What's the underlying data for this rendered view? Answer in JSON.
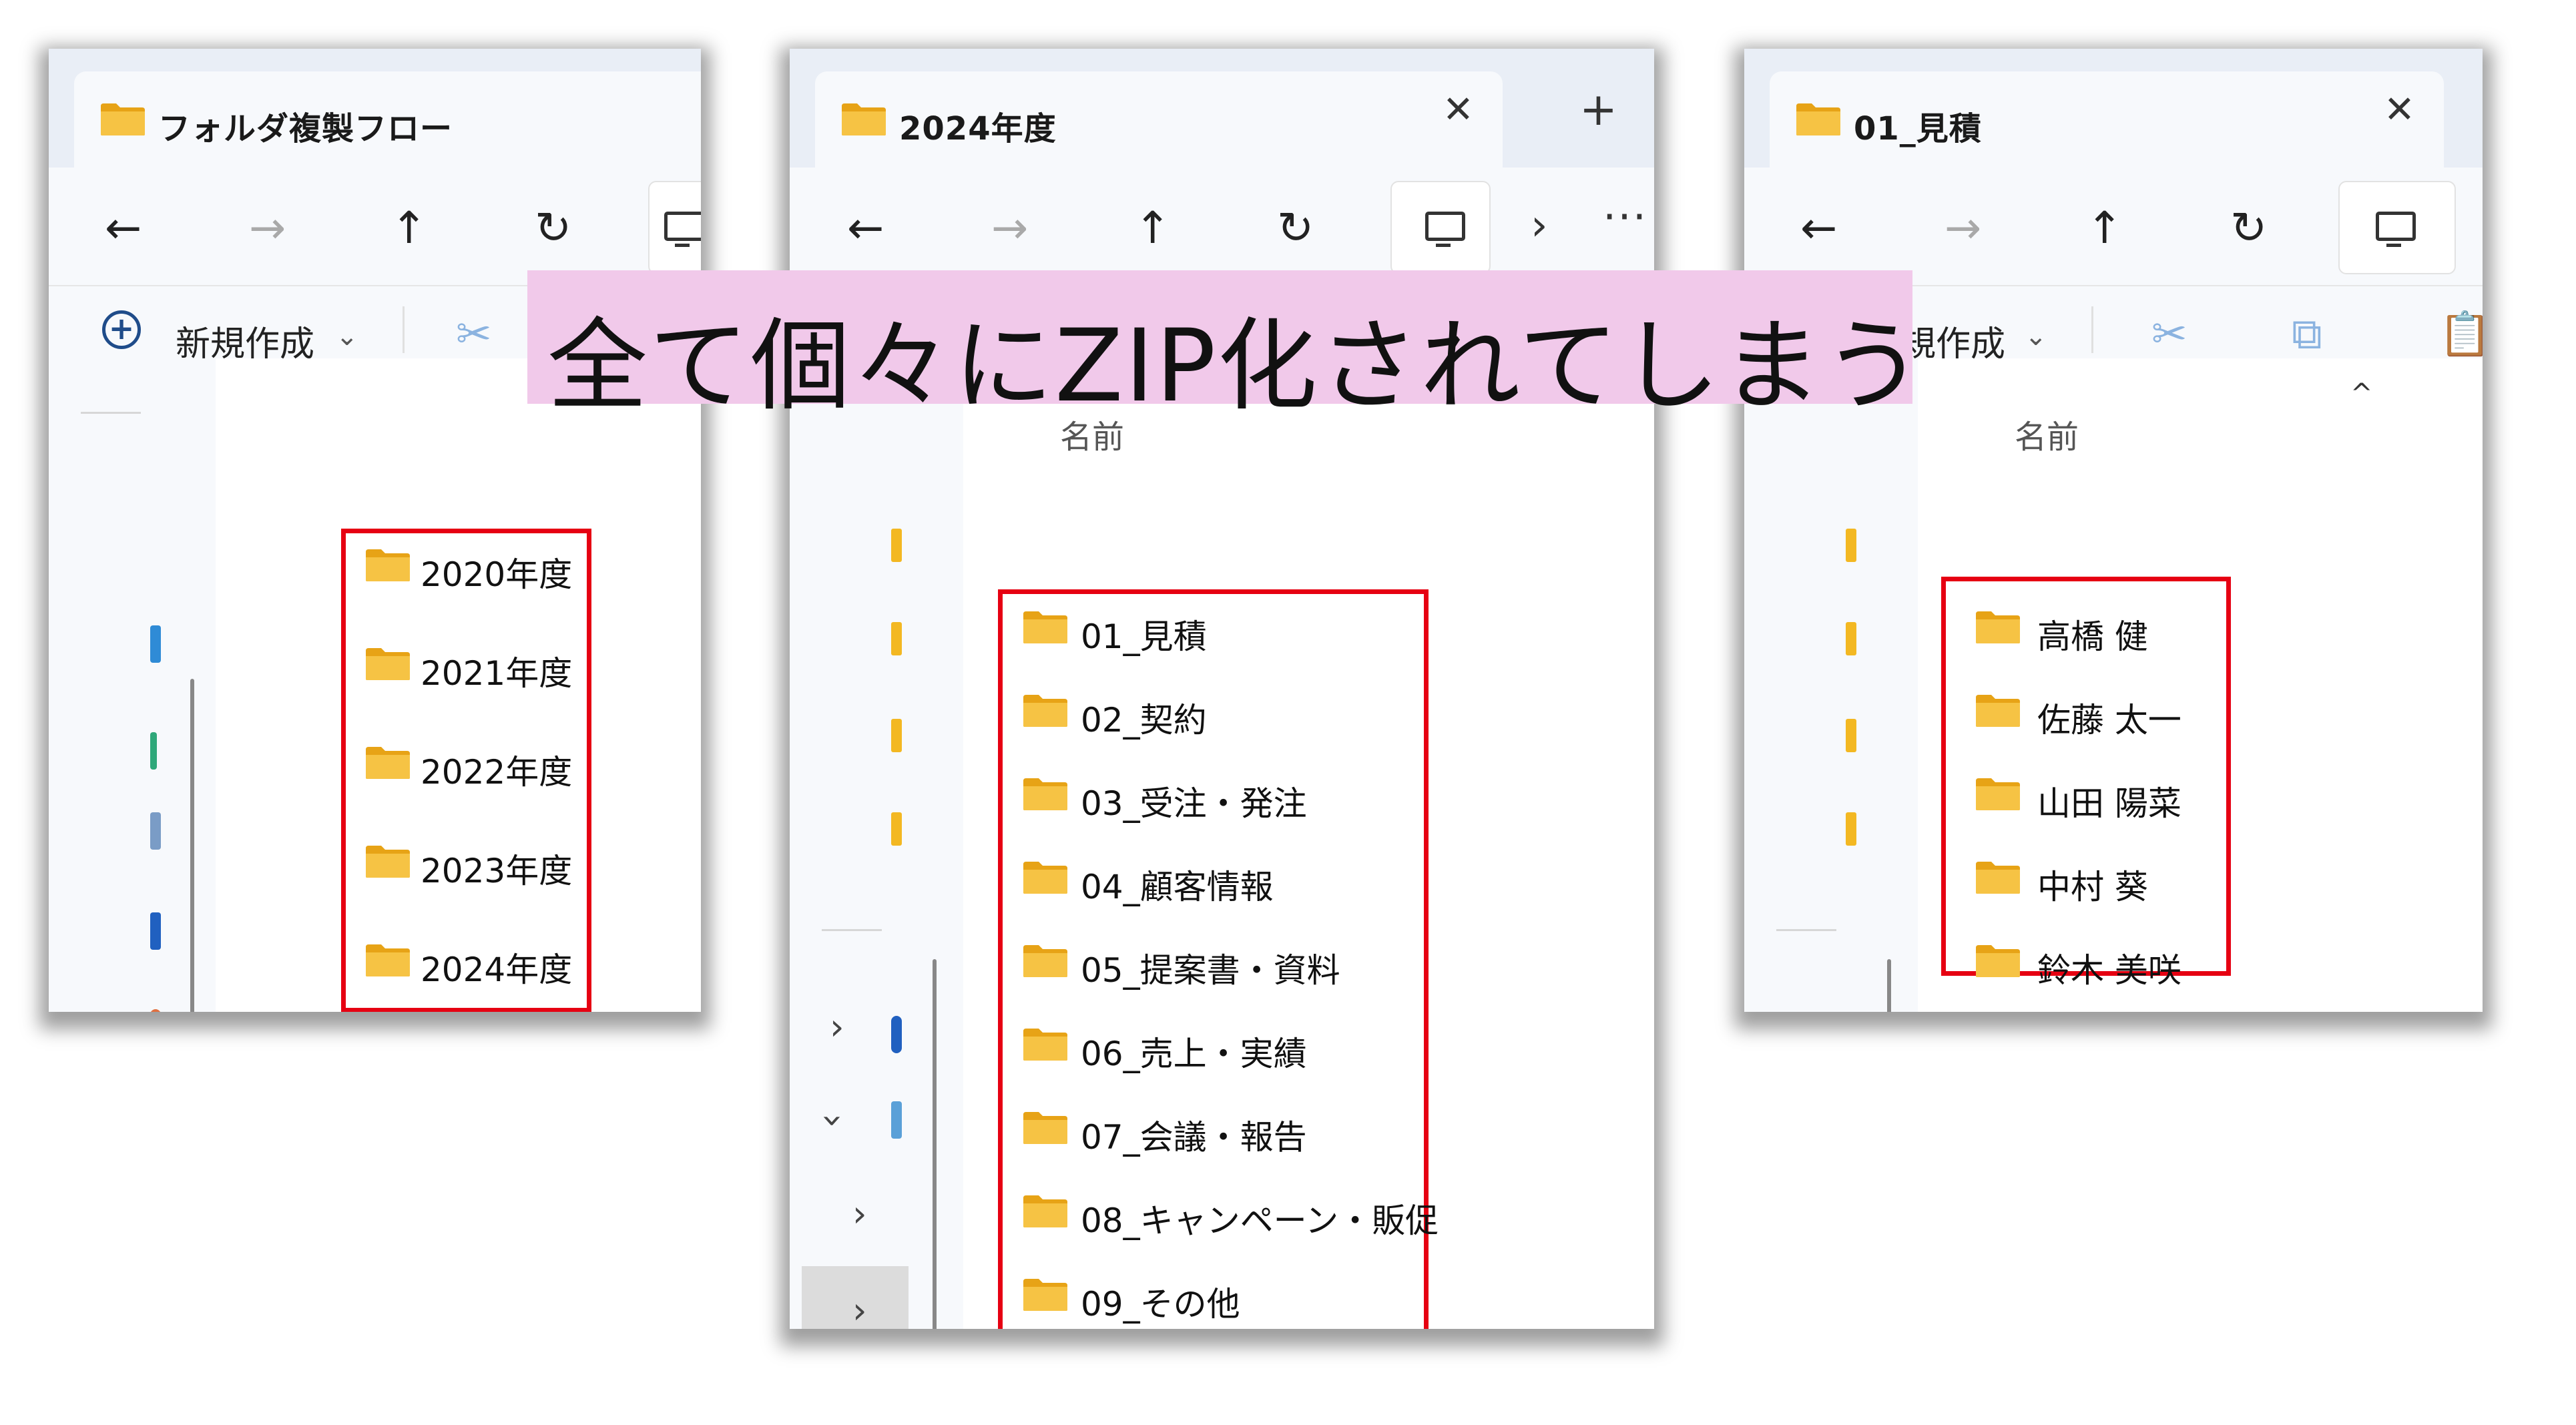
{
  "nav": {
    "back": "←",
    "forward": "→",
    "up": "↑",
    "refresh": "↻",
    "chevron": "›",
    "more": "···"
  },
  "command_bar": {
    "new_label": "新規作成",
    "new_label_partial": "規作成",
    "new_chevron": "⌄"
  },
  "column_header": {
    "name": "名前",
    "sort": "^"
  },
  "banner": {
    "text": "全て個々にZIP化されてしまう"
  },
  "windows": [
    {
      "tab_title": "フォルダ複製フロー",
      "folders": [
        "2020年度",
        "2021年度",
        "2022年度",
        "2023年度",
        "2024年度"
      ]
    },
    {
      "tab_title": "2024年度",
      "close": "✕",
      "new_tab": "+",
      "folders": [
        "01_見積",
        "02_契約",
        "03_受注・発注",
        "04_顧客情報",
        "05_提案書・資料",
        "06_売上・実績",
        "07_会議・報告",
        "08_キャンペーン・販促",
        "09_その他"
      ]
    },
    {
      "tab_title": "01_見積",
      "close": "✕",
      "folders": [
        "高橋 健",
        "佐藤 太一",
        "山田 陽菜",
        "中村 葵",
        "鈴木 美咲"
      ]
    }
  ],
  "colors": {
    "highlight_box": "#e60012",
    "banner_bg": "#f1c9ea",
    "folder": "#f3b822",
    "tab_bar": "#e9eef6"
  }
}
